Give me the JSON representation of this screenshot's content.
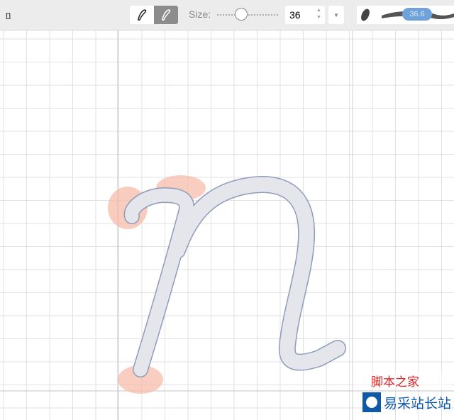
{
  "document": {
    "name": "n"
  },
  "toolbar": {
    "tools": [
      {
        "name": "pen-tool",
        "active": false
      },
      {
        "name": "brush-tool",
        "active": true
      }
    ],
    "size_label": "Size:",
    "size_value": "36",
    "slider_fraction": 0.36,
    "preview_value": "36.6"
  },
  "colors": {
    "accent": "#6fa2db",
    "outline": "#8e9cba",
    "fill": "#e4e6eb",
    "blush": "#f6b8a4"
  },
  "watermark": {
    "line1": "脚本之家",
    "line2": "易采站长站"
  }
}
